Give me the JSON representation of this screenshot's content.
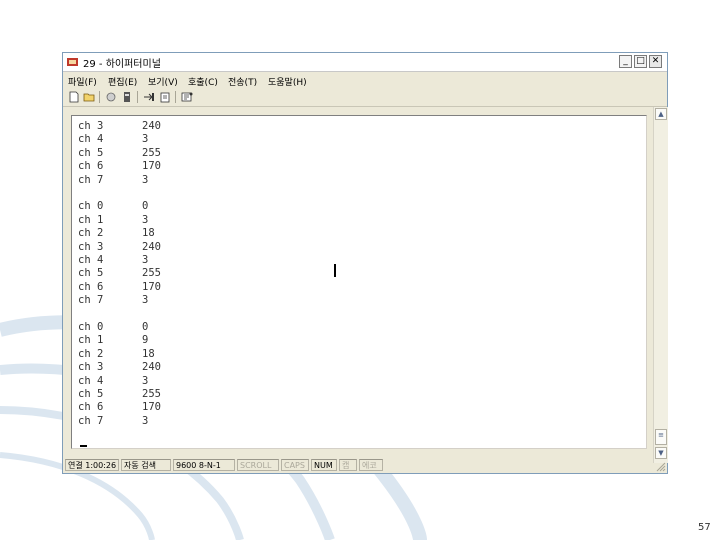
{
  "window": {
    "title": "29 - 하이퍼터미널",
    "minimize_label": "_",
    "maximize_label": "□",
    "close_label": "✕"
  },
  "menu": [
    "파일(F)",
    "편집(E)",
    "보기(V)",
    "호출(C)",
    "전송(T)",
    "도움말(H)"
  ],
  "toolbar_icons": [
    "new-icon",
    "open-icon",
    "disconnect-icon",
    "call-icon",
    "send-icon",
    "receive-icon",
    "properties-icon"
  ],
  "terminal": {
    "lines": [
      {
        "ch": "ch 3",
        "val": "240"
      },
      {
        "ch": "ch 4",
        "val": "3"
      },
      {
        "ch": "ch 5",
        "val": "255"
      },
      {
        "ch": "ch 6",
        "val": "170"
      },
      {
        "ch": "ch 7",
        "val": "3"
      },
      {
        "ch": "",
        "val": ""
      },
      {
        "ch": "ch 0",
        "val": "0"
      },
      {
        "ch": "ch 1",
        "val": "3"
      },
      {
        "ch": "ch 2",
        "val": "18"
      },
      {
        "ch": "ch 3",
        "val": "240"
      },
      {
        "ch": "ch 4",
        "val": "3"
      },
      {
        "ch": "ch 5",
        "val": "255"
      },
      {
        "ch": "ch 6",
        "val": "170"
      },
      {
        "ch": "ch 7",
        "val": "3"
      },
      {
        "ch": "",
        "val": ""
      },
      {
        "ch": "ch 0",
        "val": "0"
      },
      {
        "ch": "ch 1",
        "val": "9"
      },
      {
        "ch": "ch 2",
        "val": "18"
      },
      {
        "ch": "ch 3",
        "val": "240"
      },
      {
        "ch": "ch 4",
        "val": "3"
      },
      {
        "ch": "ch 5",
        "val": "255"
      },
      {
        "ch": "ch 6",
        "val": "170"
      },
      {
        "ch": "ch 7",
        "val": "3"
      }
    ]
  },
  "statusbar": {
    "connected": "연결 1:00:26",
    "detect": "자동 검색",
    "baud": "9600 8-N-1",
    "scroll": "SCROLL",
    "caps": "CAPS",
    "num": "NUM",
    "capture": "캡",
    "print": "에코"
  },
  "page_number": "57",
  "colors": {
    "window_bg": "#ece9d8",
    "terminal_bg": "#ffffff",
    "swirl": "#d7e3ee"
  }
}
